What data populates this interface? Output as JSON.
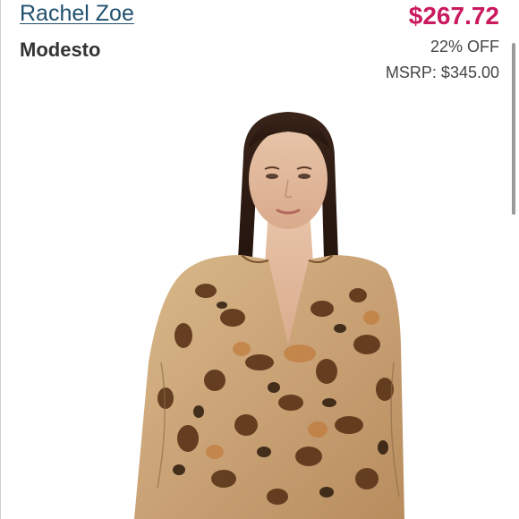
{
  "product": {
    "brand": "Rachel Zoe",
    "name": "Modesto",
    "price": "$267.72",
    "discount": "22% OFF",
    "msrp": "MSRP: $345.00"
  },
  "colors": {
    "brand_link": "#20506f",
    "price": "#c9195f",
    "text": "#333333"
  }
}
